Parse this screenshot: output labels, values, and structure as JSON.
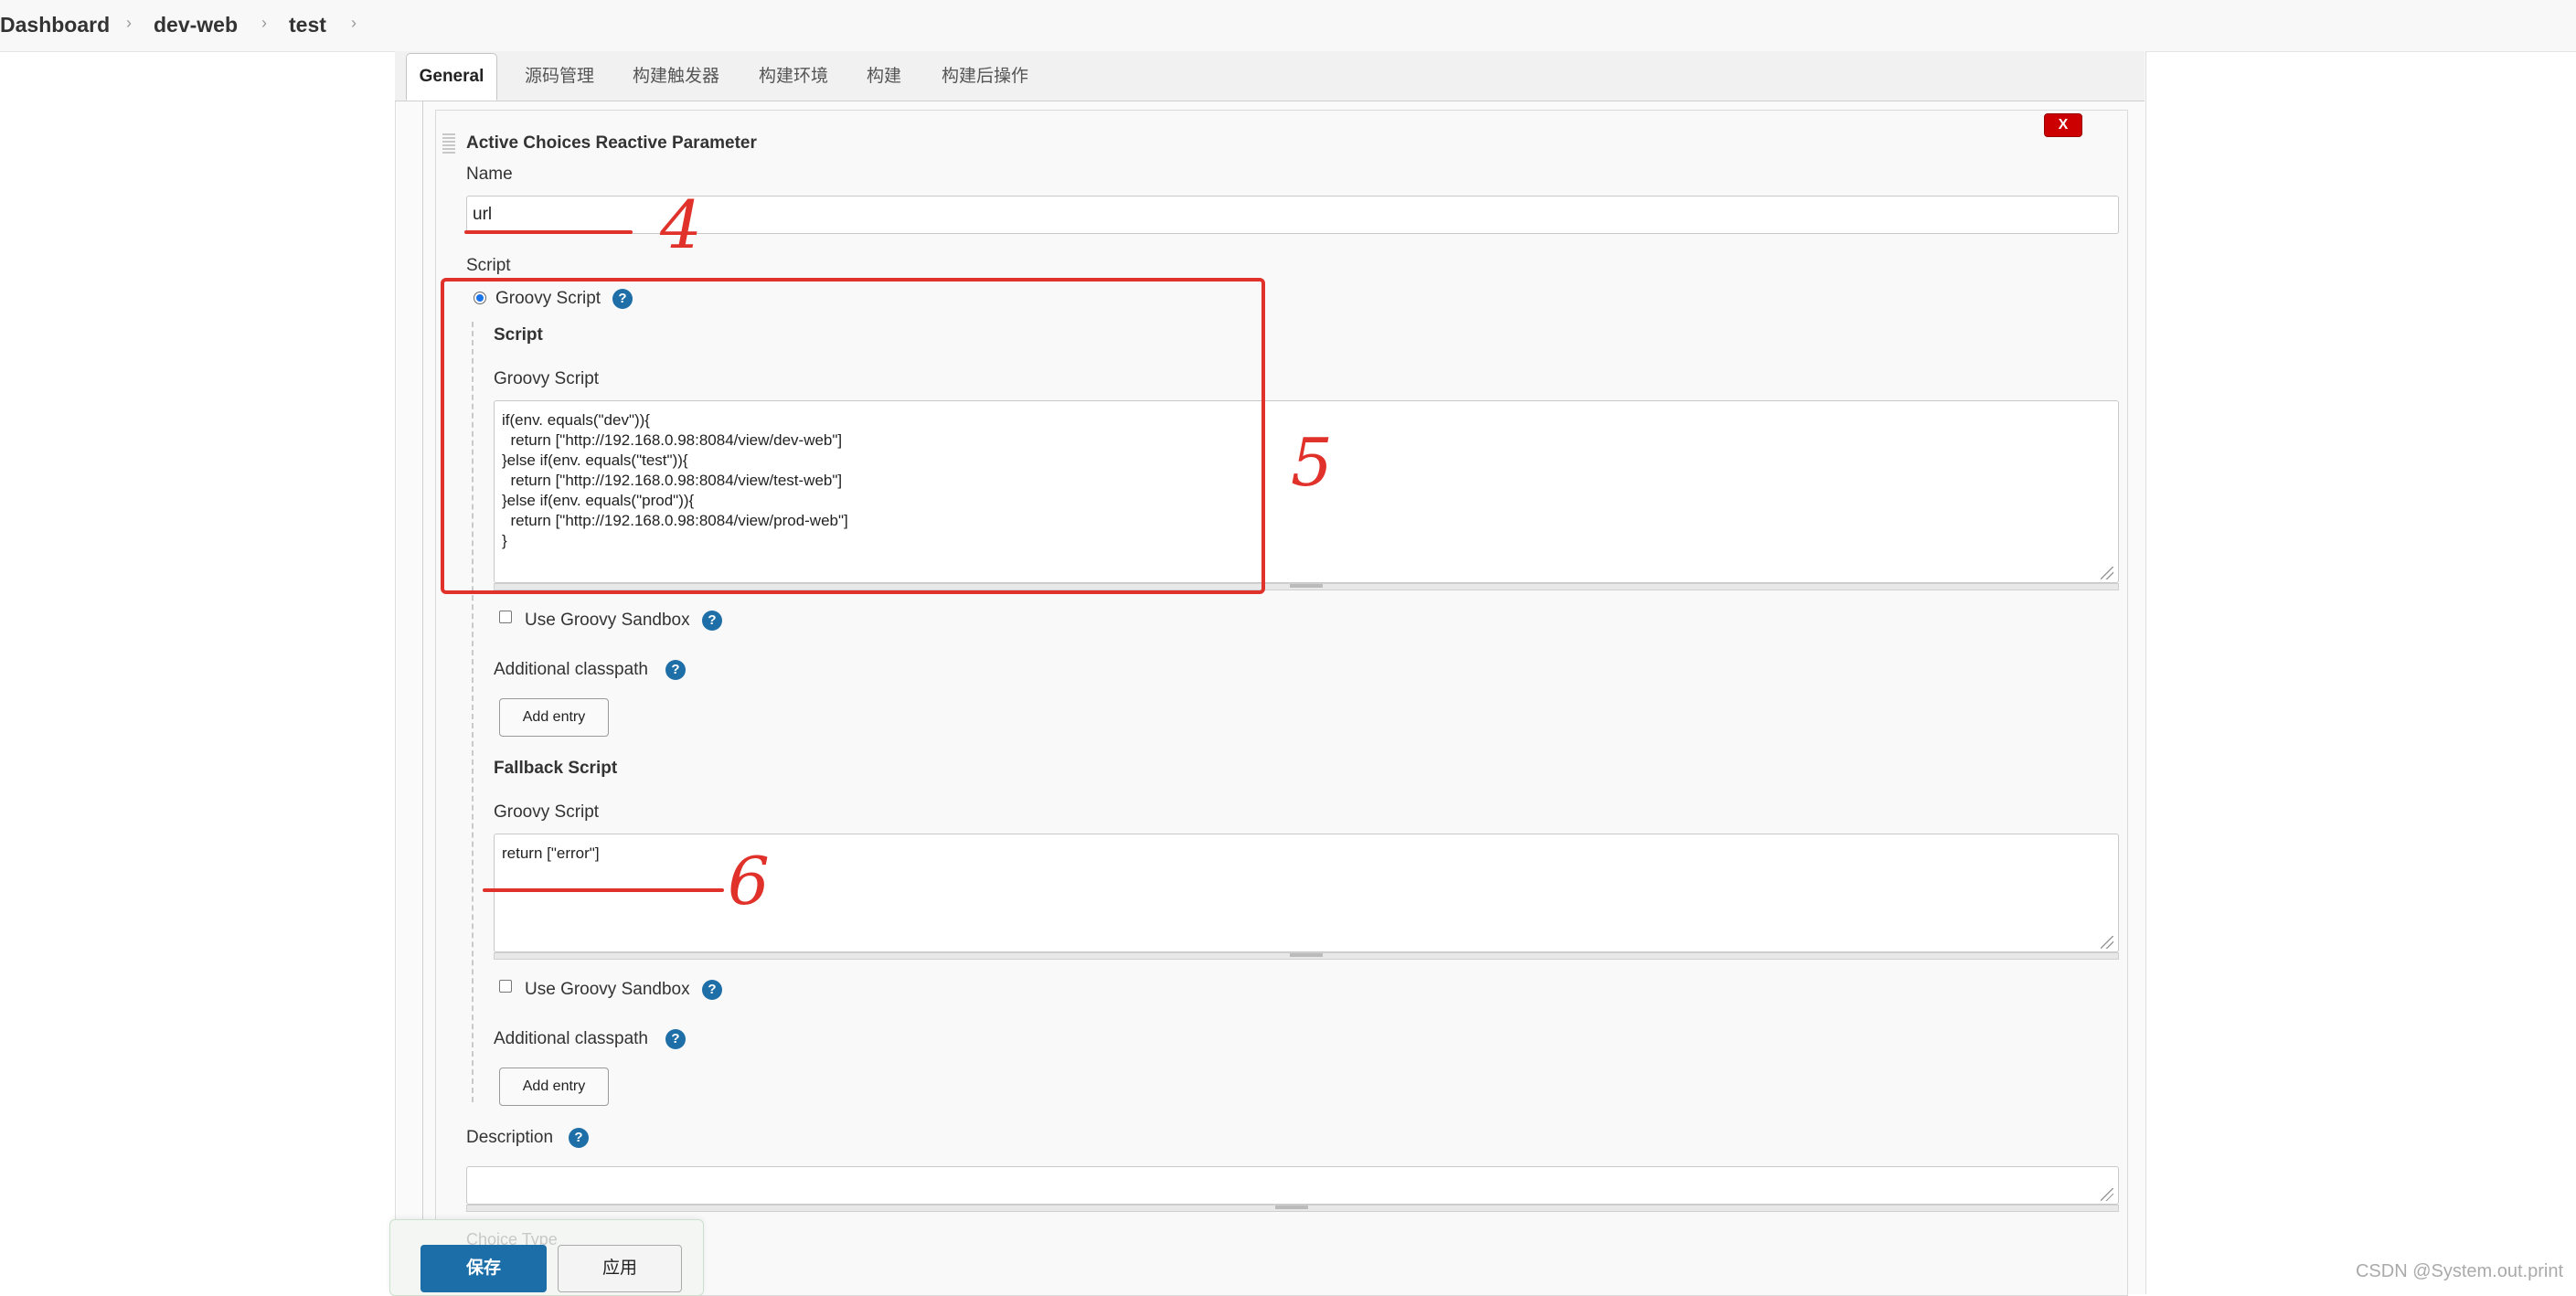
{
  "breadcrumb": {
    "items": [
      "Dashboard",
      "dev-web",
      "test"
    ]
  },
  "tabs": [
    {
      "label": "General",
      "active": true
    },
    {
      "label": "源码管理",
      "active": false
    },
    {
      "label": "构建触发器",
      "active": false
    },
    {
      "label": "构建环境",
      "active": false
    },
    {
      "label": "构建",
      "active": false
    },
    {
      "label": "构建后操作",
      "active": false
    }
  ],
  "parameter": {
    "title": "Active Choices Reactive Parameter",
    "delete_label": "X",
    "name_label": "Name",
    "name_value": "url",
    "script_label": "Script",
    "groovy_radio_label": "Groovy Script",
    "script_heading": "Script",
    "groovy_script_label": "Groovy Script",
    "groovy_script_value": "if(env. equals(\"dev\")){\n  return [\"http://192.168.0.98:8084/view/dev-web\"]\n}else if(env. equals(\"test\")){\n  return [\"http://192.168.0.98:8084/view/test-web\"]\n}else if(env. equals(\"prod\")){\n  return [\"http://192.168.0.98:8084/view/prod-web\"]\n}",
    "sandbox_label": "Use Groovy Sandbox",
    "classpath_label": "Additional classpath",
    "add_entry_label": "Add entry",
    "fallback_heading": "Fallback Script",
    "fallback_groovy_label": "Groovy Script",
    "fallback_value": "return [\"error\"]",
    "fallback_sandbox_label": "Use Groovy Sandbox",
    "fallback_classpath_label": "Additional classpath",
    "fallback_add_entry_label": "Add entry",
    "description_label": "Description",
    "description_value": "",
    "choice_type_label": "Choice Type"
  },
  "help_icon_glyph": "?",
  "actions": {
    "save_label": "保存",
    "apply_label": "应用"
  },
  "annotations": {
    "num4": "4",
    "num5": "5",
    "num6": "6"
  },
  "watermark": "CSDN @System.out.print",
  "colors": {
    "primary": "#1c6ea8",
    "annotation": "#e0312a",
    "delete": "#cc0000"
  }
}
